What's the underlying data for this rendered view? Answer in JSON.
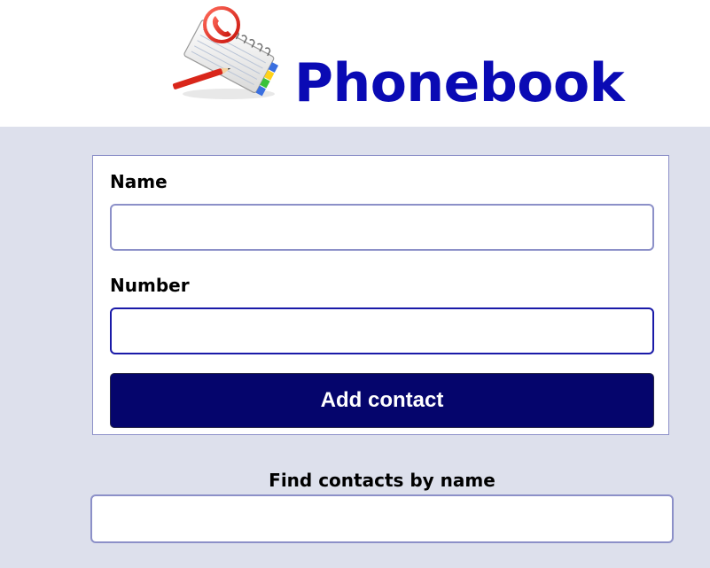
{
  "header": {
    "logo_icon": "phonebook-notepad-icon",
    "title": "Phonebook",
    "title_color": "#0a0ab4"
  },
  "form": {
    "name_label": "Name",
    "name_value": "",
    "number_label": "Number",
    "number_value": "",
    "submit_label": "Add contact",
    "submit_color": "#05056c"
  },
  "filter": {
    "label": "Find contacts by name",
    "value": ""
  },
  "colors": {
    "background": "#dde0ec",
    "border": "#8c90c8",
    "focus_border": "#1a1aa8"
  }
}
